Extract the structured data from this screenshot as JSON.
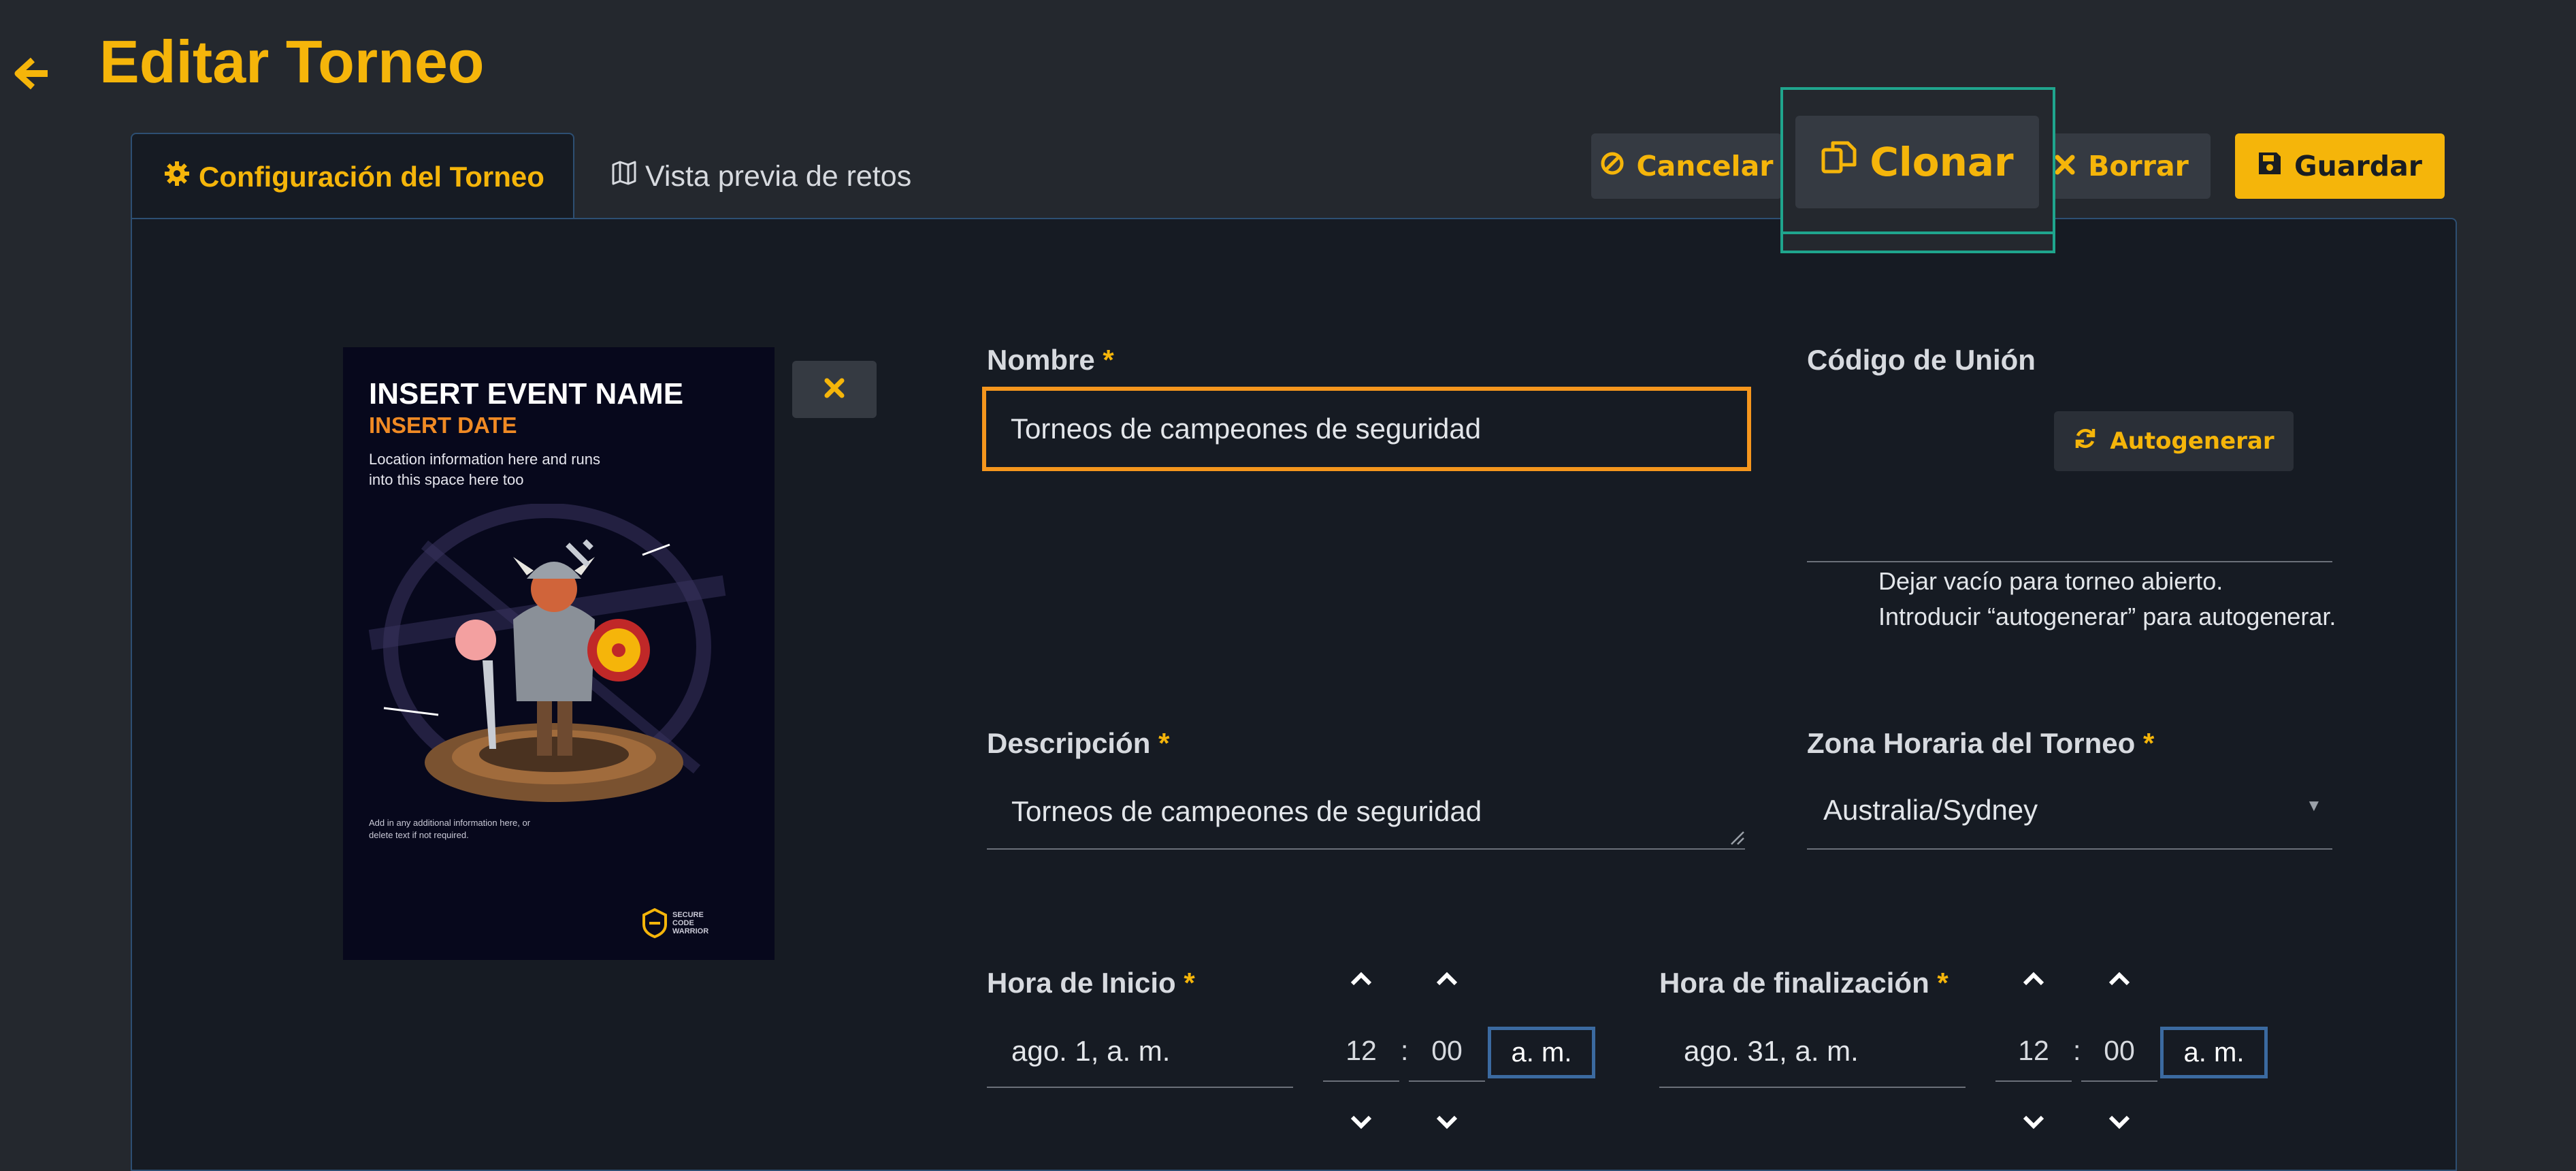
{
  "header": {
    "title": "Editar Torneo"
  },
  "tabs": [
    {
      "label": "Configuración del Torneo",
      "active": true
    },
    {
      "label": "Vista previa de retos",
      "active": false
    }
  ],
  "actions": {
    "cancel": "Cancelar",
    "clone": "Clonar",
    "delete": "Borrar",
    "save": "Guardar"
  },
  "poster": {
    "event_name": "INSERT EVENT NAME",
    "event_date": "INSERT DATE",
    "location": "Location information here and runs into this space here too",
    "extra": "Add in any additional information here, or delete text if not required.",
    "logo_text": "SECURE CODE WARRIOR"
  },
  "form": {
    "name": {
      "label": "Nombre",
      "required": "*",
      "value": "Torneos de campeones de seguridad"
    },
    "join_code": {
      "label": "Código de Unión",
      "autogen_button": "Autogenerar",
      "value": "",
      "help_1": "Dejar vacío para torneo abierto.",
      "help_2": "Introducir “autogenerar” para autogenerar."
    },
    "description": {
      "label": "Descripción",
      "required": "*",
      "value": "Torneos de campeones de seguridad"
    },
    "timezone": {
      "label": "Zona Horaria del Torneo",
      "required": "*",
      "value": "Australia/Sydney"
    },
    "start": {
      "label": "Hora de Inicio",
      "required": "*",
      "date": "ago. 1, a. m.",
      "hour": "12",
      "minute": "00",
      "separator": ":",
      "meridiem": "a. m."
    },
    "end": {
      "label": "Hora de finalización",
      "required": "*",
      "date": "ago. 31, a. m.",
      "hour": "12",
      "minute": "00",
      "separator": ":",
      "meridiem": "a. m."
    }
  },
  "colors": {
    "accent": "#f5b50a",
    "focus": "#f5961d",
    "panel": "#161b23",
    "background": "#24282e",
    "border": "#2d4f73",
    "clone_highlight": "#1fa58d"
  }
}
